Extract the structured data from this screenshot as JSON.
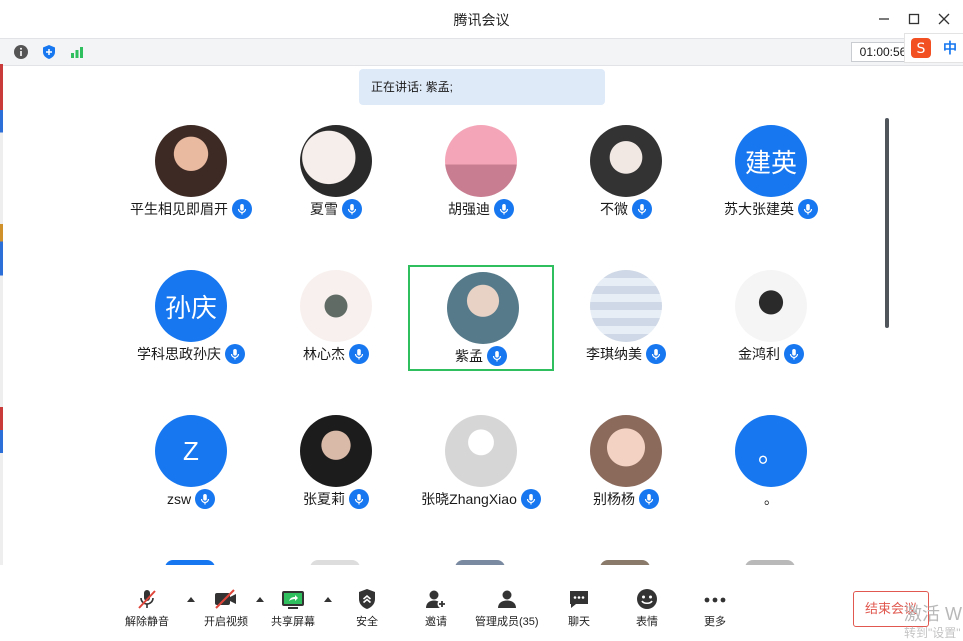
{
  "window": {
    "title": "腾讯会议"
  },
  "status": {
    "timer": "01:00:56",
    "ime_label": "中"
  },
  "speaking": {
    "text": "正在讲话: 紫孟;"
  },
  "participants": [
    {
      "name": "平生相见即眉开",
      "avatar_text": "",
      "mic": true
    },
    {
      "name": "夏雪",
      "avatar_text": "",
      "mic": true
    },
    {
      "name": "胡强迪",
      "avatar_text": "",
      "mic": true
    },
    {
      "name": "不微",
      "avatar_text": "",
      "mic": true
    },
    {
      "name": "苏大张建英",
      "avatar_text": "建英",
      "mic": true
    },
    {
      "name": "学科思政孙庆",
      "avatar_text": "孙庆",
      "mic": true
    },
    {
      "name": "林心杰",
      "avatar_text": "",
      "mic": true
    },
    {
      "name": "紫孟",
      "avatar_text": "",
      "mic": true,
      "active": true
    },
    {
      "name": "李琪纳美",
      "avatar_text": "",
      "mic": true
    },
    {
      "name": "金鸿利",
      "avatar_text": "",
      "mic": true
    },
    {
      "name": "zsw",
      "avatar_text": "Z",
      "mic": true
    },
    {
      "name": "张夏莉",
      "avatar_text": "",
      "mic": true
    },
    {
      "name": "张晓ZhangXiao",
      "avatar_text": "",
      "mic": true
    },
    {
      "name": "别杨杨",
      "avatar_text": "",
      "mic": true
    },
    {
      "name": "。",
      "avatar_text": "。",
      "mic": false
    }
  ],
  "toolbar": {
    "unmute": "解除静音",
    "video": "开启视频",
    "share": "共享屏幕",
    "security": "安全",
    "invite": "邀请",
    "members": "管理成员(35)",
    "chat": "聊天",
    "reactions": "表情",
    "more": "更多",
    "end": "结束会议"
  },
  "watermark": {
    "line1": "激活 W",
    "line2": "转到\"设置\""
  },
  "colors": {
    "accent": "#1677f0",
    "active_border": "#2fbf5f",
    "end": "#e0584f"
  }
}
